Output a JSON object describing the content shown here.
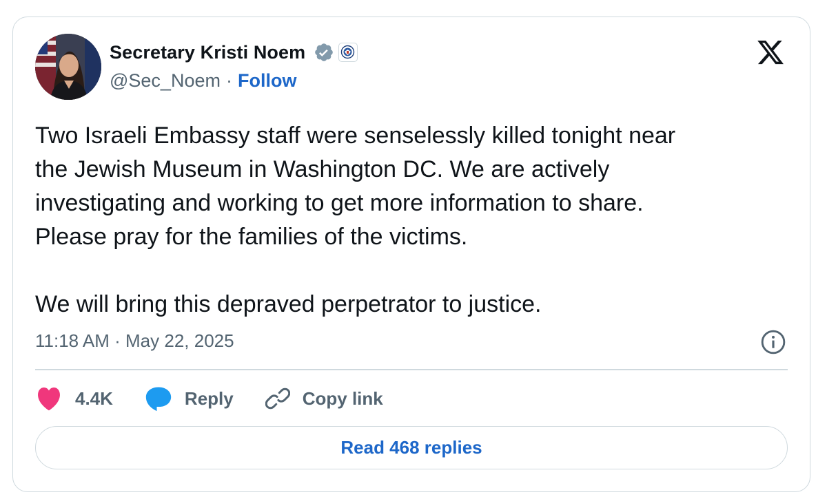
{
  "author": {
    "display_name": "Secretary Kristi Noem",
    "handle": "@Sec_Noem",
    "separator": "·",
    "follow_label": "Follow"
  },
  "icons": {
    "verified": "verified-badge-icon",
    "affiliate": "dhs-seal-icon",
    "logo": "x-logo-icon",
    "info": "info-icon",
    "like": "heart-icon",
    "reply": "speech-bubble-icon",
    "copy": "link-icon"
  },
  "tweet": {
    "text": "Two Israeli Embassy staff were senselessly killed tonight near\nthe Jewish Museum in Washington DC. We are actively\ninvestigating and working to get more information to share.\nPlease pray for the families of the victims.\n\nWe will bring this depraved perpetrator to justice.",
    "timestamp": "11:18 AM · May 22, 2025"
  },
  "actions": {
    "like_count": "4.4K",
    "reply_label": "Reply",
    "copy_link_label": "Copy link"
  },
  "read_replies_label": "Read 468 replies",
  "colors": {
    "link_blue": "#1d67c9",
    "like_pink": "#f91880",
    "reply_blue": "#1d9bf0",
    "muted_text": "#536471",
    "border": "#cfd9de"
  }
}
